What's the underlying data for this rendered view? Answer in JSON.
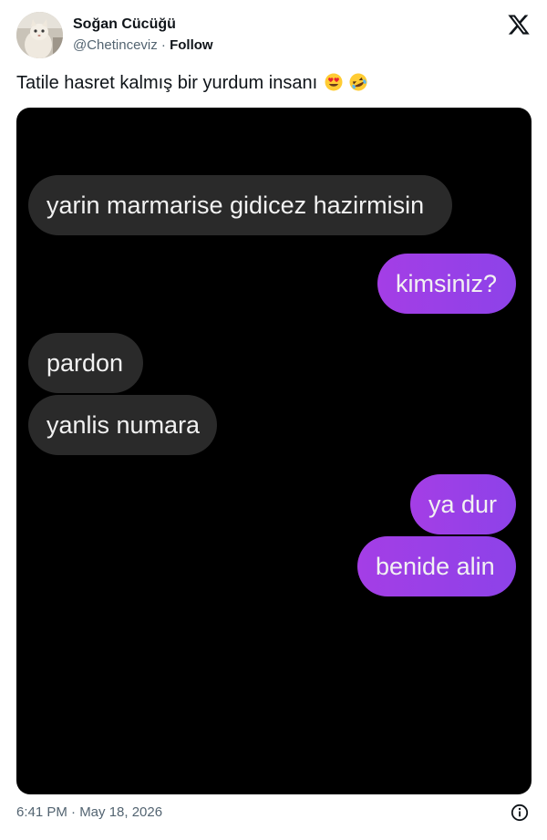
{
  "author": {
    "name": "Soğan Cücüğü",
    "handle": "@Chetinceviz",
    "separator": " · ",
    "follow_label": "Follow",
    "avatar_icon": "cat-avatar"
  },
  "platform_icon": "x-logo-icon",
  "tweet": {
    "text": "Tatile hasret kalmış bir yurdum insanı",
    "emojis": [
      "heart-eyes-emoji",
      "rofl-emoji"
    ]
  },
  "chat": {
    "background": "#000000",
    "incoming_color": "#2a2a2a",
    "outgoing_color": "#9b3fe0",
    "messages": [
      {
        "side": "incoming",
        "text": "yarin marmarise gidicez hazirmisin"
      },
      {
        "side": "outgoing",
        "text": "kimsiniz?"
      },
      {
        "side": "incoming",
        "text": "pardon"
      },
      {
        "side": "incoming",
        "text": "yanlis numara"
      },
      {
        "side": "outgoing",
        "text": "ya dur"
      },
      {
        "side": "outgoing",
        "text": "benide alin"
      }
    ]
  },
  "footer": {
    "timestamp": "6:41 PM · May 18, 2026",
    "info_icon": "info-icon"
  }
}
